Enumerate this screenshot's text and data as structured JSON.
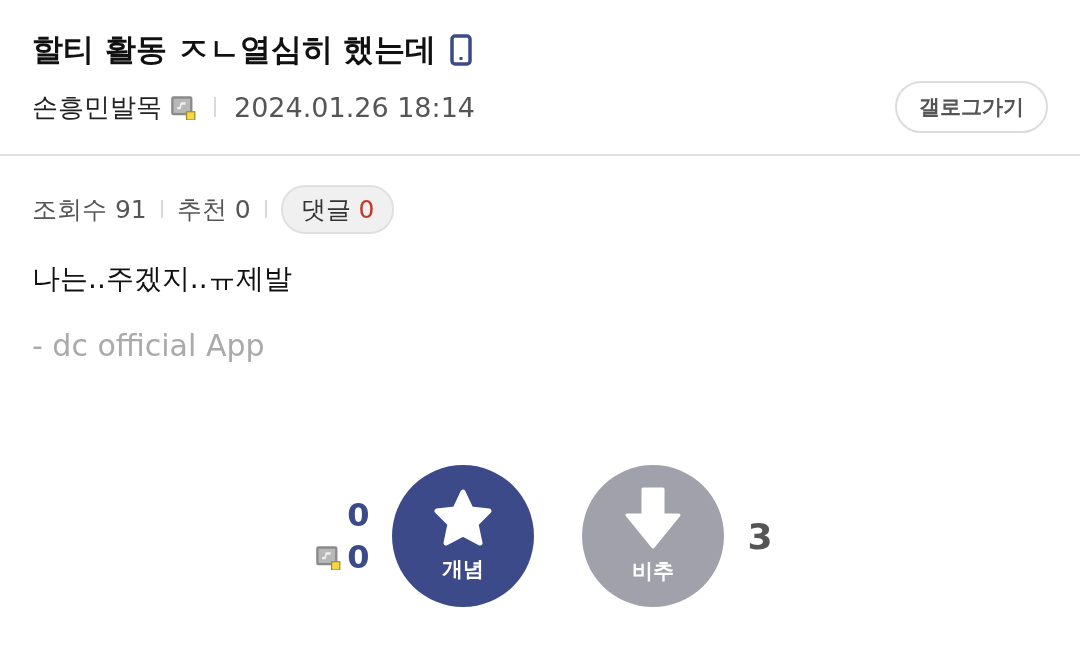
{
  "post": {
    "title": "할티 활동 ㅈㄴ열심히 했는데",
    "author": "손흥민발목",
    "date": "2024.01.26 18:14",
    "gallog_button": "갤로그가기"
  },
  "stats": {
    "views_label": "조회수",
    "views": "91",
    "recommend_label": "추천",
    "recommend": "0",
    "comments_label": "댓글",
    "comments": "0"
  },
  "body": {
    "text": "나는..주겠지..ㅠ제발",
    "footer": "- dc official App"
  },
  "votes": {
    "up_count": "0",
    "fixed_up_count": "0",
    "up_label": "개념",
    "down_label": "비추",
    "down_count": "3"
  }
}
